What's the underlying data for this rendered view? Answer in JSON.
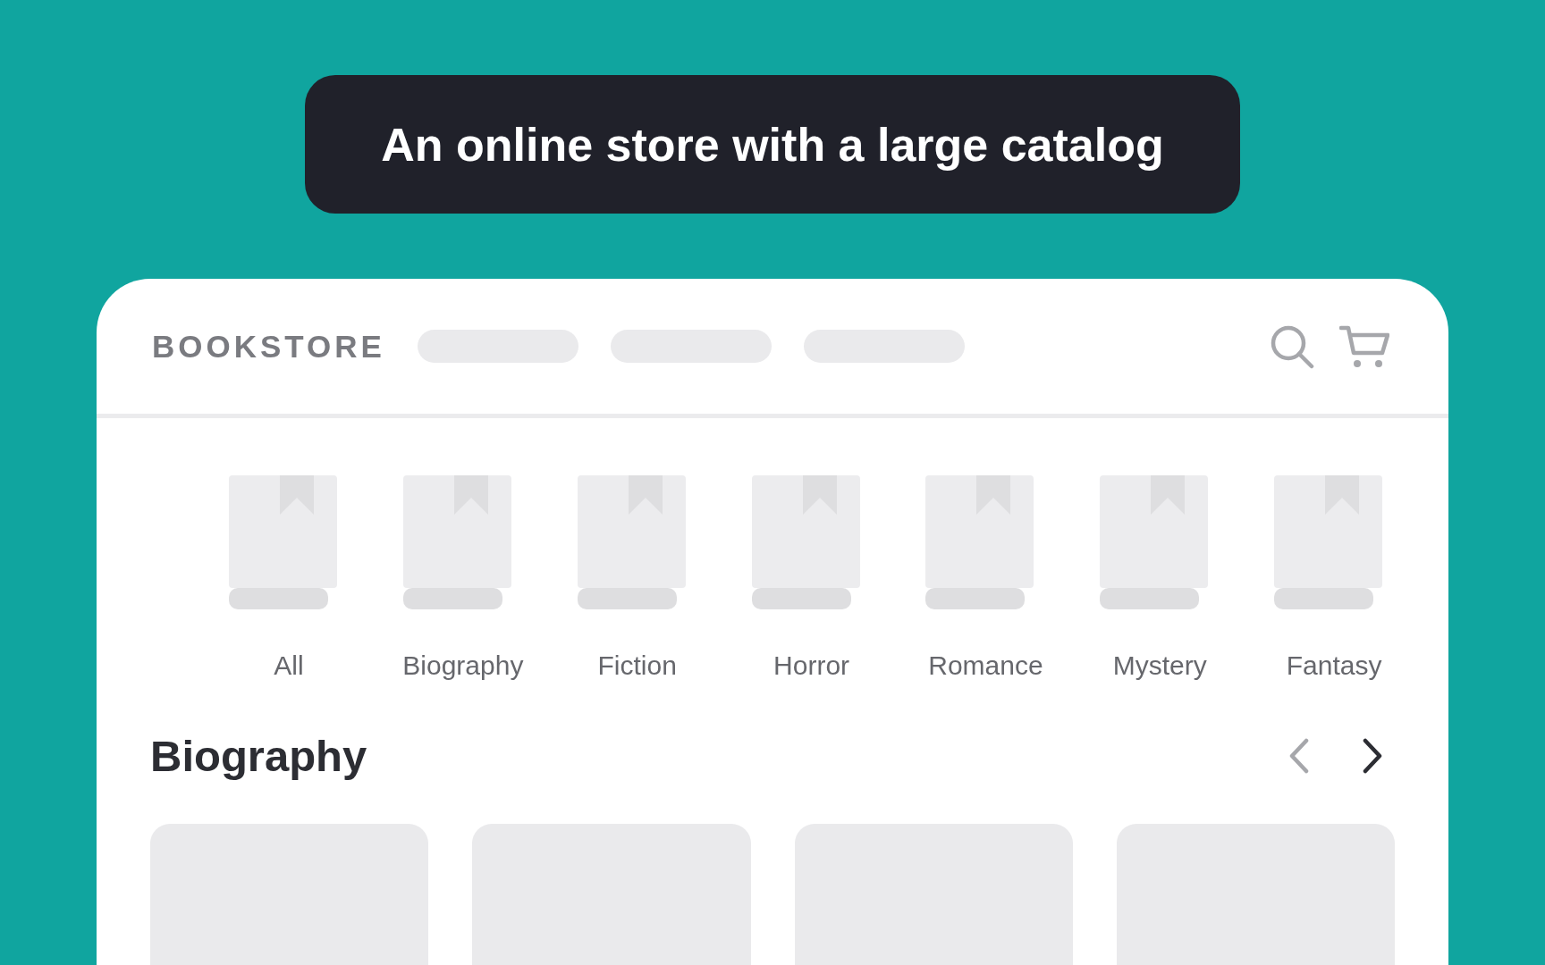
{
  "banner": {
    "title": "An online store with a large catalog"
  },
  "header": {
    "logo": "BOOKSTORE"
  },
  "categories": [
    {
      "label": "All"
    },
    {
      "label": "Biography"
    },
    {
      "label": "Fiction"
    },
    {
      "label": "Horror"
    },
    {
      "label": "Romance"
    },
    {
      "label": "Mystery"
    },
    {
      "label": "Fantasy"
    }
  ],
  "section": {
    "title": "Biography",
    "prev": {
      "disabled": true
    },
    "next": {
      "disabled": false
    }
  }
}
